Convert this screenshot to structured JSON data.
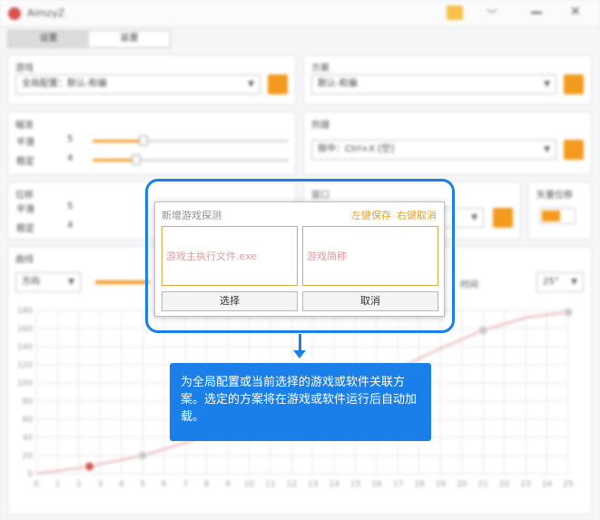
{
  "app": {
    "title": "AimzyZ",
    "tabs": [
      "设置",
      "装置"
    ]
  },
  "groups": {
    "game": {
      "label": "游戏",
      "select": "全局配置：默认-和偏"
    },
    "scheme": {
      "label": "方案",
      "select": "默认-和偏"
    },
    "aim": {
      "label": "瞄准",
      "rows": [
        {
          "label": "平滑",
          "value": "5",
          "fill": 0.26
        },
        {
          "label": "稳定",
          "value": "4",
          "fill": 0.22
        }
      ]
    },
    "hotkey": {
      "label": "热键",
      "select": "按中：Ctrl+X [空]"
    },
    "position": {
      "label": "位移",
      "rows": [
        {
          "label": "平滑",
          "value": "5"
        },
        {
          "label": "稳定",
          "value": "4"
        }
      ]
    },
    "window": {
      "label": "窗口"
    },
    "offset": {
      "label": "矢量位移"
    },
    "curve": {
      "label": "曲线",
      "select": "方向",
      "time_label": "时间",
      "angle": "25°"
    }
  },
  "chart_data": {
    "type": "line",
    "title": "",
    "xlabel": "",
    "ylabel": "",
    "x_ticks": [
      "0",
      "1",
      "2",
      "3",
      "4",
      "5",
      "6",
      "7",
      "8",
      "9",
      "10",
      "11",
      "12",
      "13",
      "14",
      "15",
      "16",
      "17",
      "18",
      "19",
      "20",
      "21",
      "22",
      "23",
      "24",
      "25"
    ],
    "y_ticks": [
      "0",
      "20",
      "40",
      "60",
      "80",
      "100",
      "120",
      "140",
      "160",
      "180"
    ],
    "xlim": [
      0,
      25
    ],
    "ylim": [
      0,
      180
    ],
    "series": [
      {
        "x": [
          0,
          2.5,
          5,
          7,
          9,
          11,
          13,
          15,
          17,
          19,
          21,
          23,
          25
        ],
        "y": [
          0,
          8,
          20,
          34,
          50,
          66,
          84,
          100,
          116,
          138,
          158,
          172,
          178
        ]
      }
    ],
    "control_points": [
      {
        "x": 2.5,
        "y": 8
      },
      {
        "x": 5,
        "y": 20
      },
      {
        "x": 21,
        "y": 158
      },
      {
        "x": 25,
        "y": 178
      }
    ],
    "colors": {
      "line": "#e8b4b4",
      "grid": "#e6e6e6",
      "point": "#c8c8c8",
      "active_point": "#d9534f"
    }
  },
  "dialog": {
    "title": "新增游戏探测",
    "hint_save": "左键保存",
    "hint_cancel": "右键取消",
    "exe_placeholder": "游戏主执行文件.exe",
    "name_placeholder": "游戏简称",
    "select_label": "选择",
    "cancel_label": "取消"
  },
  "callout": {
    "text": "为全局配置或当前选择的游戏或软件关联方案。选定的方案将在游戏或软件运行后自动加载。"
  },
  "colors": {
    "accent": "#1a7fe8",
    "orange": "#f39a1e"
  }
}
